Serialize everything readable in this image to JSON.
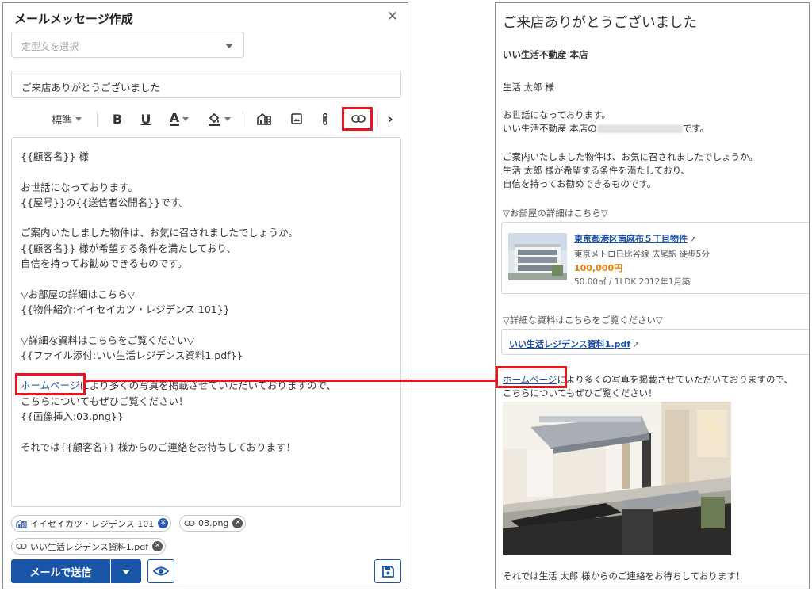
{
  "compose": {
    "title": "メールメッセージ作成",
    "close_glyph": "✕",
    "template_placeholder": "定型文を選択",
    "subject": "ご来店ありがとうございました",
    "toolbar": {
      "font_size_label": "標準",
      "bold": "B",
      "underline": "U",
      "text_color": "A",
      "more": "›"
    },
    "body_lines": [
      "{{顧客名}} 様",
      "",
      "お世話になっております。",
      "{{屋号}}の{{送信者公開名}}です。",
      "",
      "ご案内いたしました物件は、お気に召されましたでしょうか。",
      "{{顧客名}} 様が希望する条件を満たしており、",
      "自信を持ってお勧めできるものです。",
      "",
      "▽お部屋の詳細はこちら▽",
      "{{物件紹介:イイセイカツ・レジデンス 101}}",
      "",
      "▽詳細な資料はこちらをご覧ください▽",
      "{{ファイル添付:いい生活レジデンス資料1.pdf}}",
      ""
    ],
    "link_line": {
      "link": "ホームページ",
      "rest": "により多くの写真を掲載させていただいておりますので、"
    },
    "body_lines_after": [
      "こちらについてもぜひご覧ください！",
      "{{画像挿入:03.png}}",
      "",
      "それでは{{顧客名}} 様からのご連絡をお待ちしております！"
    ],
    "chips": [
      {
        "label": "イイセイカツ・レジデンス 101",
        "icon": "building-icon"
      },
      {
        "label": "03.png",
        "icon": "link-icon"
      },
      {
        "label": "いい生活レジデンス資料1.pdf",
        "icon": "link-icon"
      }
    ],
    "send_label": "メールで送信"
  },
  "preview": {
    "subject": "ご来店ありがとうございました",
    "shop": "いい生活不動産 本店",
    "recipient": "生活 太郎 様",
    "greeting1": "お世話になっております。",
    "greeting2_a": "いい生活不動産 本店の",
    "greeting2_b": "です。",
    "para1": "ご案内いたしました物件は、お気に召されましたでしょうか。",
    "para2": "生活 太郎 様が希望する条件を満たしており、",
    "para3": "自信を持ってお勧めできるものです。",
    "room_heading": "▽お部屋の詳細はこちら▽",
    "property": {
      "title": "東京都港区南麻布５丁目物件",
      "station": "東京メトロ日比谷線 広尾駅 徒歩5分",
      "price": "100,000円",
      "spec": "50.00㎡ / 1LDK 2012年1月築"
    },
    "docs_heading": "▽詳細な資料はこちらをご覧ください▽",
    "file_link": "いい生活レジデンス資料1.pdf",
    "hp_link": "ホームページ",
    "hp_rest": "により多くの写真を掲載させていただいておりますので、",
    "hp_rest2": "こちらについてもぜひご覧ください！",
    "closing": "それでは生活 太郎 様からのご連絡をお待ちしております！"
  },
  "colors": {
    "primary": "#1a56a8",
    "highlight": "#e8141e",
    "price": "#e8820c",
    "link": "#1a4fa0"
  }
}
